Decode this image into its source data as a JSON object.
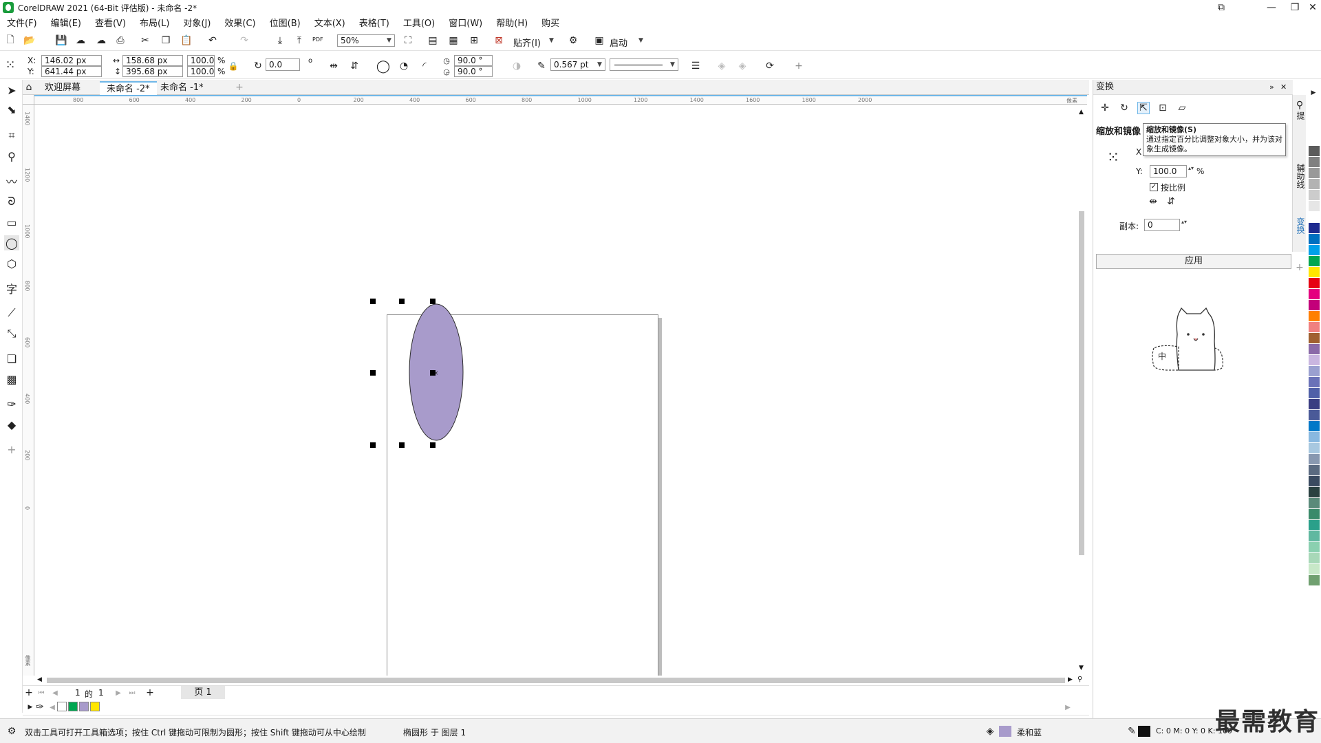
{
  "window": {
    "title": "CorelDRAW 2021 (64-Bit 评估版) - 未命名 -2*"
  },
  "menu": [
    "文件(F)",
    "编辑(E)",
    "查看(V)",
    "布局(L)",
    "对象(J)",
    "效果(C)",
    "位图(B)",
    "文本(X)",
    "表格(T)",
    "工具(O)",
    "窗口(W)",
    "帮助(H)",
    "购买"
  ],
  "standard_toolbar": {
    "zoom_value": "50%",
    "snap_label": "贴齐(I)",
    "launch_label": "启动",
    "pdf_label": "PDF"
  },
  "property_bar": {
    "x_label": "X:",
    "y_label": "Y:",
    "x_value": "146.02 px",
    "y_value": "641.44 px",
    "width_value": "158.68 px",
    "height_value": "395.68 px",
    "scale_x": "100.0",
    "scale_y": "100.0",
    "percent": "%",
    "rotation": "0.0",
    "degree_symbol": "o",
    "start_angle": "90.0 °",
    "end_angle": "90.0 °",
    "outline_width": "0.567 pt"
  },
  "doc_tabs": [
    "欢迎屏幕",
    "未命名 -2*",
    "未命名 -1*"
  ],
  "active_tab_index": 1,
  "ruler": {
    "h_ticks": [
      "800",
      "600",
      "400",
      "200",
      "0",
      "200",
      "400",
      "600",
      "800",
      "1000",
      "1200",
      "1400",
      "1600",
      "1800",
      "2000"
    ],
    "h_unit": "像素",
    "v_ticks": [
      "1400",
      "1200",
      "1000",
      "800",
      "600",
      "400",
      "200",
      "0"
    ],
    "v_unit": "像素"
  },
  "page_nav": {
    "current": "1",
    "of_label": "的",
    "total": "1",
    "page_tab": "页 1"
  },
  "status": {
    "hint": "双击工具可打开工具箱选项；按住 Ctrl 键拖动可限制为圆形；按住 Shift 键拖动可从中心绘制",
    "object_info": "椭圆形 于 图层 1",
    "fill_name": "柔和蓝",
    "cmyk": "C: 0 M: 0 Y: 0 K: 100"
  },
  "docker": {
    "title": "变换",
    "section": "缩放和镜像",
    "x_label": "X",
    "y_label": "Y:",
    "y_value": "100.0",
    "percent": "%",
    "proportional": "按比例",
    "copies_label": "副本:",
    "copies_value": "0",
    "apply": "应用",
    "tooltip_title": "缩放和镜像(S)",
    "tooltip_body": "通过指定百分比调整对象大小，并为该对象生成镜像。"
  },
  "sidetabs": [
    "辅助线",
    "变换"
  ],
  "sidetab_top_partial": "提",
  "watermark": "最需教育",
  "illustration_text": "中",
  "colors": {
    "ellipse_fill": "#A89BCB",
    "accent_blue": "#6FB7E8"
  },
  "palette": [
    "#5b5b5b",
    "#808080",
    "#999999",
    "#b3b3b3",
    "#cccccc",
    "#e6e6e6",
    "#ffffff",
    "#1e2b8f",
    "#0070c0",
    "#00a0e9",
    "#00a651",
    "#ffe600",
    "#e60012",
    "#e4007f",
    "#c3007a",
    "#ff7f00",
    "#f08080",
    "#a06030",
    "#8a6aa8",
    "#c9b6e0",
    "#9aa0d0",
    "#6a72b8",
    "#5060a8",
    "#3a3d82",
    "#4a5a98",
    "#0078c8",
    "#88b8e0",
    "#a8c8e0",
    "#8898b0",
    "#5a6a80",
    "#3a4a60",
    "#2a4040",
    "#5a8a7a",
    "#3a8a6a",
    "#2aa08a",
    "#60b8a0",
    "#8ad0b0",
    "#a8d8b8",
    "#c8e8c8",
    "#70a070"
  ],
  "doc_palette": [
    "#ffffff",
    "#00a651",
    "#A89BCB",
    "#ffe600"
  ]
}
